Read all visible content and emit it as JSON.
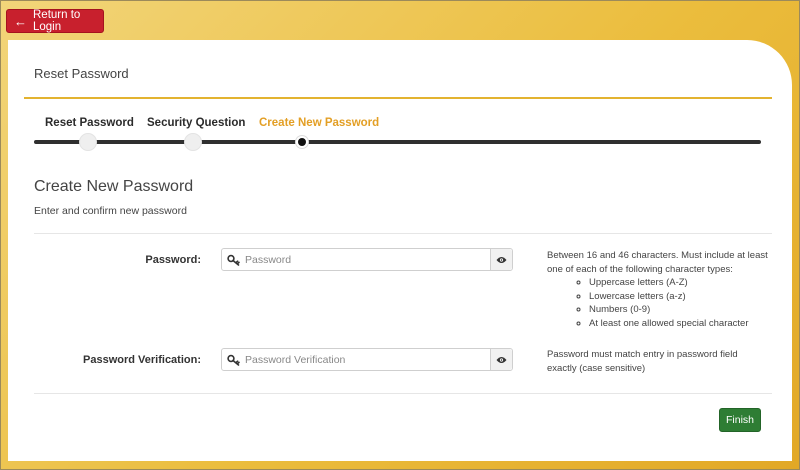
{
  "return_button": {
    "label": "Return to Login",
    "icon": "arrow-left-icon"
  },
  "card": {
    "title": "Reset Password"
  },
  "steps": [
    {
      "label": "Reset Password",
      "state": "complete"
    },
    {
      "label": "Security Question",
      "state": "complete"
    },
    {
      "label": "Create New Password",
      "state": "current"
    }
  ],
  "form": {
    "title": "Create New Password",
    "subtitle": "Enter and confirm new password",
    "password": {
      "label": "Password:",
      "placeholder": "Password",
      "value": "",
      "icon": "key-icon",
      "toggle_icon": "eye-icon"
    },
    "verification": {
      "label": "Password Verification:",
      "placeholder": "Password Verification",
      "value": "",
      "icon": "key-icon",
      "toggle_icon": "eye-icon"
    },
    "password_help": {
      "intro": "Between 16 and 46 characters. Must include at least one of each of the following character types:",
      "rules": [
        "Uppercase letters (A-Z)",
        "Lowercase letters (a-z)",
        "Numbers (0-9)",
        "At least one allowed special character"
      ]
    },
    "verification_help": "Password must match entry in password field exactly (case sensitive)",
    "finish_label": "Finish"
  },
  "colors": {
    "background_gold": "#ebbd3d",
    "accent_gold": "#e3b330",
    "active_step": "#e39f25",
    "return_button": "#c8202d",
    "finish_button": "#2e7d34"
  }
}
